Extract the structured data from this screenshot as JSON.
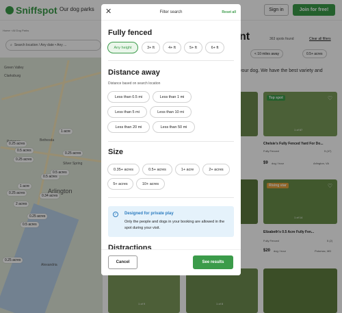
{
  "header": {
    "logo": "Sniffspot",
    "nav_link": "Our dog parks",
    "signin": "Sign in",
    "join": "Join for free!"
  },
  "breadcrumb": "Home  ›  All Dog Parks",
  "search": {
    "placeholder": "Search location / Any date • Any ..."
  },
  "results": {
    "count": "363 spots found",
    "clear_all": "Clear all filters"
  },
  "filter_chips": [
    "< 10 miles away",
    "0.5+ acres"
  ],
  "page_heading": "nt",
  "page_subtext": "your dog. We have the best variety and",
  "map": {
    "labels": [
      "Green Valley",
      "Clarksburg",
      "Potomac",
      "Bethesda",
      "Silver Spring",
      "Arlington",
      "Alexandria"
    ],
    "markers": [
      "1 acre",
      "0.25 acres",
      "0.5 acres",
      "0.25 acres",
      "0.25 acres",
      "0.5 acres",
      "0.5 acres",
      "1 acre",
      "0.25 acres",
      "0.34 acres",
      "2 acres",
      "0.25 acres",
      "0.5 acres",
      "0.25 acres"
    ]
  },
  "cards": [
    {
      "badge": "Top spot",
      "counter": "1 of 67",
      "title": "Chelsie's Fully Fenced Yard For Do...",
      "rating": "5 (47)",
      "tag": "Fully Fenced",
      "price": "$9",
      "unit": "dog / hour",
      "location": "Arlington, VA"
    },
    {
      "badge": "Rising star",
      "counter": "1 of 14",
      "title": "Elizabeth's 0.5 Acre Fully Fen...",
      "rating": "5 (2)",
      "tag": "Fully Fenced",
      "price": "$20",
      "unit": "dog / hour",
      "location": "Potomac, MD"
    },
    {
      "counter": "1 of 9"
    },
    {
      "counter": "1 of 8"
    }
  ],
  "modal": {
    "title": "Filter search",
    "reset": "Reset all",
    "fenced": {
      "heading": "Fully fenced",
      "options": [
        "Any height",
        "3+ ft",
        "4+ ft",
        "5+ ft",
        "6+ ft"
      ],
      "selected": "Any height"
    },
    "distance": {
      "heading": "Distance away",
      "subtitle": "Distance based on search location",
      "options": [
        "Less than 0.5 mi",
        "Less than 1 mi",
        "Less than 5 mi",
        "Less than 10 mi",
        "Less than 20 mi",
        "Less than 50 mi"
      ]
    },
    "size": {
      "heading": "Size",
      "options": [
        "0.35+ acres",
        "0.5+ acres",
        "1+ acre",
        "2+ acres",
        "5+ acres",
        "10+ acres"
      ]
    },
    "info": {
      "title": "Designed for private play",
      "text": "Only the people and dogs in your booking are allowed in the spot during your visit."
    },
    "distractions_heading": "Distractions",
    "cancel": "Cancel",
    "see": "See results"
  }
}
